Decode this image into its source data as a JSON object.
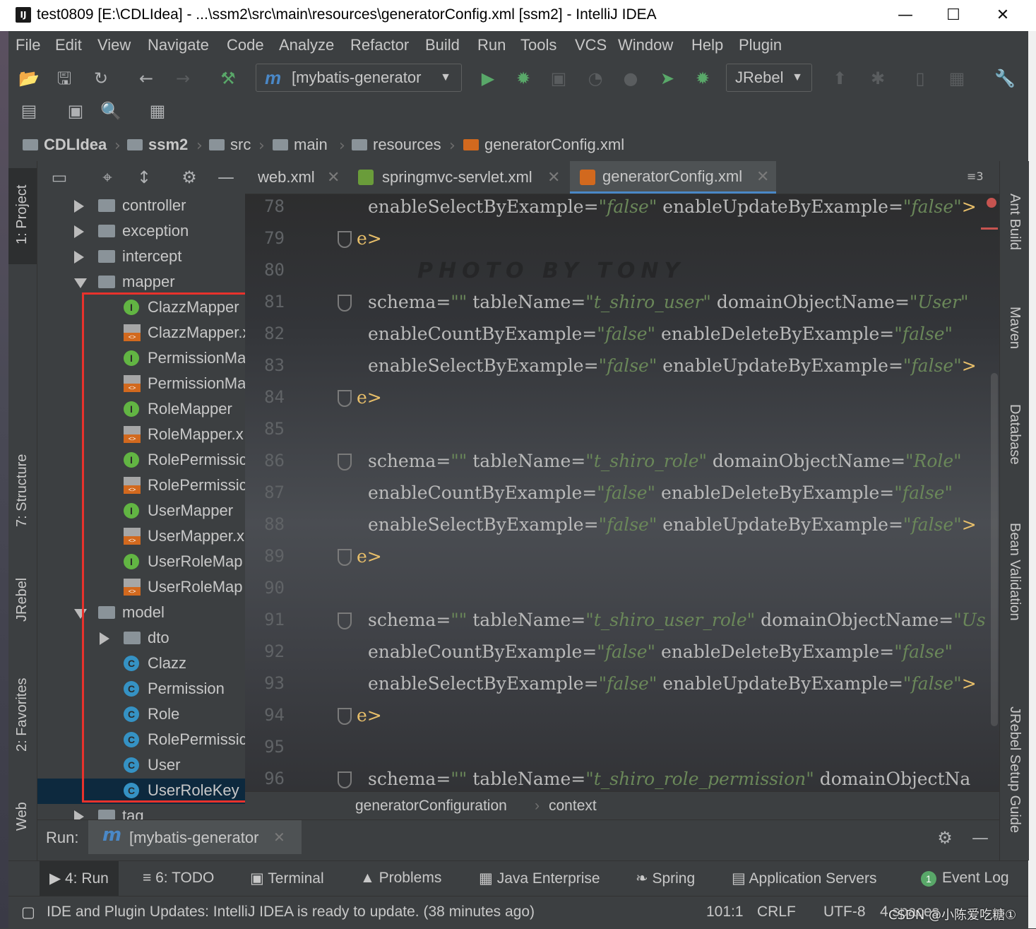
{
  "window": {
    "title": "test0809 [E:\\CDLIdea] - ...\\ssm2\\src\\main\\resources\\generatorConfig.xml [ssm2] - IntelliJ IDEA",
    "app_logo": "IJ",
    "minimize": "—",
    "maximize": "☐",
    "close": "✕"
  },
  "menu": [
    "File",
    "Edit",
    "View",
    "Navigate",
    "Code",
    "Analyze",
    "Refactor",
    "Build",
    "Run",
    "Tools",
    "VCS",
    "Window",
    "Help",
    "Plugin"
  ],
  "toolbar": {
    "run_config": "[mybatis-generator",
    "jrebel": "JRebel"
  },
  "breadcrumb": [
    "CDLIdea",
    "ssm2",
    "src",
    "main",
    "resources",
    "generatorConfig.xml"
  ],
  "left_tool_tabs": [
    "1: Project",
    "7: Structure",
    "JRebel",
    "2: Favorites",
    "Web"
  ],
  "right_tool_tabs": [
    "Ant Build",
    "Maven",
    "Database",
    "Bean Validation",
    "JRebel Setup Guide"
  ],
  "project_tree": [
    {
      "label": "controller",
      "kind": "folder",
      "expand": "right",
      "indent": 0
    },
    {
      "label": "exception",
      "kind": "folder",
      "expand": "right",
      "indent": 0
    },
    {
      "label": "intercept",
      "kind": "folder",
      "expand": "right",
      "indent": 0
    },
    {
      "label": "mapper",
      "kind": "folder",
      "expand": "down",
      "indent": 0
    },
    {
      "label": "ClazzMapper",
      "kind": "interface",
      "indent": 1
    },
    {
      "label": "ClazzMapper.x",
      "kind": "xml",
      "indent": 1
    },
    {
      "label": "PermissionMa",
      "kind": "interface",
      "indent": 1
    },
    {
      "label": "PermissionMa",
      "kind": "xml",
      "indent": 1
    },
    {
      "label": "RoleMapper",
      "kind": "interface",
      "indent": 1
    },
    {
      "label": "RoleMapper.x",
      "kind": "xml",
      "indent": 1
    },
    {
      "label": "RolePermissic",
      "kind": "interface",
      "indent": 1
    },
    {
      "label": "RolePermissic",
      "kind": "xml",
      "indent": 1
    },
    {
      "label": "UserMapper",
      "kind": "interface",
      "indent": 1
    },
    {
      "label": "UserMapper.x",
      "kind": "xml",
      "indent": 1
    },
    {
      "label": "UserRoleMap",
      "kind": "interface",
      "indent": 1
    },
    {
      "label": "UserRoleMap",
      "kind": "xml",
      "indent": 1
    },
    {
      "label": "model",
      "kind": "folder",
      "expand": "down",
      "indent": 0
    },
    {
      "label": "dto",
      "kind": "folder",
      "expand": "right",
      "indent": 1
    },
    {
      "label": "Clazz",
      "kind": "class",
      "indent": 1
    },
    {
      "label": "Permission",
      "kind": "class",
      "indent": 1
    },
    {
      "label": "Role",
      "kind": "class",
      "indent": 1
    },
    {
      "label": "RolePermissic",
      "kind": "class",
      "indent": 1
    },
    {
      "label": "User",
      "kind": "class",
      "indent": 1
    },
    {
      "label": "UserRoleKey",
      "kind": "class",
      "indent": 1,
      "selected": true
    },
    {
      "label": "tag",
      "kind": "folder",
      "expand": "right",
      "indent": 0
    }
  ],
  "editor_tabs": [
    {
      "label": "web.xml",
      "active": false
    },
    {
      "label": "springmvc-servlet.xml",
      "active": false
    },
    {
      "label": "generatorConfig.xml",
      "active": true
    }
  ],
  "tab_overflow": "≡3",
  "watermark": "PHOTO BY TONY",
  "code": [
    {
      "n": "78",
      "parts": [
        [
          "a",
          "enableSelectByExample="
        ],
        [
          "v",
          "\"false\""
        ],
        [
          "a",
          " enableUpdateByExample="
        ],
        [
          "v",
          "\"false\""
        ],
        [
          "t",
          ">"
        ]
      ],
      "indent": true
    },
    {
      "n": "79",
      "parts": [
        [
          "t",
          "e>"
        ]
      ],
      "indent": false,
      "fold": true
    },
    {
      "n": "80",
      "parts": [],
      "indent": false
    },
    {
      "n": "81",
      "parts": [
        [
          "a",
          "schema="
        ],
        [
          "v",
          "\"\""
        ],
        [
          "a",
          " tableName="
        ],
        [
          "v",
          "\"t_shiro_user\""
        ],
        [
          "a",
          " domainObjectName="
        ],
        [
          "v",
          "\"User\""
        ]
      ],
      "indent": true,
      "fold": true
    },
    {
      "n": "82",
      "parts": [
        [
          "a",
          "enableCountByExample="
        ],
        [
          "v",
          "\"false\""
        ],
        [
          "a",
          " enableDeleteByExample="
        ],
        [
          "v",
          "\"false\""
        ]
      ],
      "indent": true
    },
    {
      "n": "83",
      "parts": [
        [
          "a",
          "enableSelectByExample="
        ],
        [
          "v",
          "\"false\""
        ],
        [
          "a",
          " enableUpdateByExample="
        ],
        [
          "v",
          "\"false\""
        ],
        [
          "t",
          ">"
        ]
      ],
      "indent": true
    },
    {
      "n": "84",
      "parts": [
        [
          "t",
          "e>"
        ]
      ],
      "indent": false,
      "fold": true
    },
    {
      "n": "85",
      "parts": [],
      "indent": false
    },
    {
      "n": "86",
      "parts": [
        [
          "a",
          "schema="
        ],
        [
          "v",
          "\"\""
        ],
        [
          "a",
          " tableName="
        ],
        [
          "v",
          "\"t_shiro_role\""
        ],
        [
          "a",
          " domainObjectName="
        ],
        [
          "v",
          "\"Role\""
        ]
      ],
      "indent": true,
      "fold": true
    },
    {
      "n": "87",
      "parts": [
        [
          "a",
          "enableCountByExample="
        ],
        [
          "v",
          "\"false\""
        ],
        [
          "a",
          " enableDeleteByExample="
        ],
        [
          "v",
          "\"false\""
        ]
      ],
      "indent": true
    },
    {
      "n": "88",
      "parts": [
        [
          "a",
          "enableSelectByExample="
        ],
        [
          "v",
          "\"false\""
        ],
        [
          "a",
          " enableUpdateByExample="
        ],
        [
          "v",
          "\"false\""
        ],
        [
          "t",
          ">"
        ]
      ],
      "indent": true
    },
    {
      "n": "89",
      "parts": [
        [
          "t",
          "e>"
        ]
      ],
      "indent": false,
      "fold": true
    },
    {
      "n": "90",
      "parts": [],
      "indent": false
    },
    {
      "n": "91",
      "parts": [
        [
          "a",
          "schema="
        ],
        [
          "v",
          "\"\""
        ],
        [
          "a",
          " tableName="
        ],
        [
          "v",
          "\"t_shiro_user_role\""
        ],
        [
          "a",
          " domainObjectName="
        ],
        [
          "v",
          "\"Us"
        ]
      ],
      "indent": true,
      "fold": true
    },
    {
      "n": "92",
      "parts": [
        [
          "a",
          "enableCountByExample="
        ],
        [
          "v",
          "\"false\""
        ],
        [
          "a",
          " enableDeleteByExample="
        ],
        [
          "v",
          "\"false\""
        ]
      ],
      "indent": true
    },
    {
      "n": "93",
      "parts": [
        [
          "a",
          "enableSelectByExample="
        ],
        [
          "v",
          "\"false\""
        ],
        [
          "a",
          " enableUpdateByExample="
        ],
        [
          "v",
          "\"false\""
        ],
        [
          "t",
          ">"
        ]
      ],
      "indent": true
    },
    {
      "n": "94",
      "parts": [
        [
          "t",
          "e>"
        ]
      ],
      "indent": false,
      "fold": true
    },
    {
      "n": "95",
      "parts": [],
      "indent": false
    },
    {
      "n": "96",
      "parts": [
        [
          "a",
          "schema="
        ],
        [
          "v",
          "\"\""
        ],
        [
          "a",
          " tableName="
        ],
        [
          "v",
          "\"t_shiro_role_permission\""
        ],
        [
          "a",
          " domainObjectNa"
        ]
      ],
      "indent": true,
      "fold": true
    }
  ],
  "editor_breadcrumb": [
    "generatorConfiguration",
    "context"
  ],
  "run_panel": {
    "label": "Run:",
    "tab": "[mybatis-generator"
  },
  "bottom_tabs": [
    {
      "label": "4: Run",
      "icon": "▶",
      "active": true
    },
    {
      "label": "6: TODO",
      "icon": "≡",
      "active": false
    },
    {
      "label": "Terminal",
      "icon": "▣",
      "active": false
    },
    {
      "label": "Problems",
      "icon": "▲",
      "active": false
    },
    {
      "label": "Java Enterprise",
      "icon": "▦",
      "active": false
    },
    {
      "label": "Spring",
      "icon": "❧",
      "active": false
    },
    {
      "label": "Application Servers",
      "icon": "▤",
      "active": false
    },
    {
      "label": "Event Log",
      "icon": "1",
      "active": false
    }
  ],
  "status": {
    "message": "IDE and Plugin Updates: IntelliJ IDEA is ready to update. (38 minutes ago)",
    "position": "101:1",
    "line_sep": "CRLF",
    "encoding": "UTF-8",
    "indent": "4 spaces"
  },
  "watermark_csdn": "CSDN @小陈爱吃糖①",
  "colors": {
    "bg": "#3c3f41",
    "attr": "#bababa",
    "value": "#6a8759",
    "tag": "#e8bf6a",
    "selection": "#0d293e",
    "highlight_box": "#e8322c"
  }
}
